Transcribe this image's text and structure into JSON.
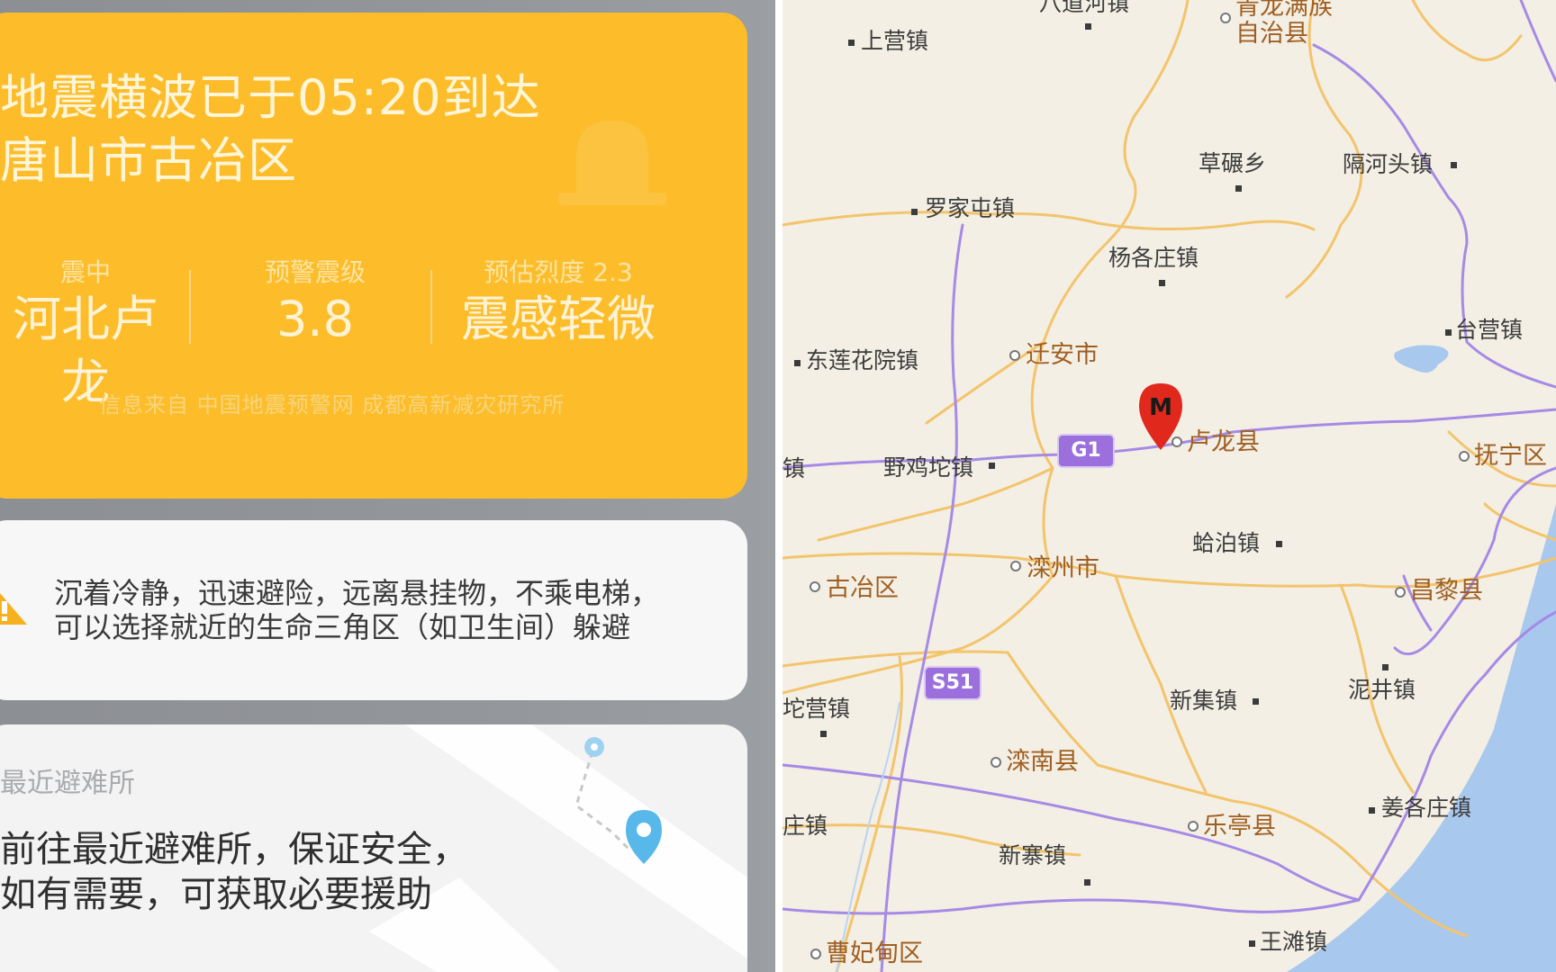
{
  "alert": {
    "title": "地震横波已于05:20到达\n唐山市古冶区",
    "epicenter_label": "震中",
    "epicenter_value": "河北卢龙",
    "magnitude_label": "预警震级",
    "magnitude_value": "3.8",
    "intensity_label": "预估烈度 2.3",
    "intensity_value": "震感轻微",
    "source": "信息来自 中国地震预警网 成都高新减灾研究所"
  },
  "advice": {
    "text": "沉着冷静，迅速避险，远离悬挂物，不乘电梯，\n可以选择就近的生命三角区（如卫生间）躲避"
  },
  "shelter": {
    "title": "最近避难所",
    "text": "前往最近避难所，保证安全，\n如有需要，可获取必要援助"
  },
  "map": {
    "places": [
      {
        "name": "八道河镇"
      },
      {
        "name": "青龙满族"
      },
      {
        "name": "自治县"
      },
      {
        "name": "上营镇"
      },
      {
        "name": "草碾乡"
      },
      {
        "name": "隔河头镇"
      },
      {
        "name": "罗家屯镇"
      },
      {
        "name": "杨各庄镇"
      },
      {
        "name": "台营镇"
      },
      {
        "name": "东莲花院镇"
      },
      {
        "name": "迁安市"
      },
      {
        "name": "卢龙县"
      },
      {
        "name": "抚宁区"
      },
      {
        "name": "野鸡坨镇"
      },
      {
        "name": "蛤泊镇"
      },
      {
        "name": "古冶区"
      },
      {
        "name": "滦州市"
      },
      {
        "name": "昌黎县"
      },
      {
        "name": "泥井镇"
      },
      {
        "name": "坨营镇"
      },
      {
        "name": "新集镇"
      },
      {
        "name": "滦南县"
      },
      {
        "name": "庄镇"
      },
      {
        "name": "姜各庄镇"
      },
      {
        "name": "乐亭县"
      },
      {
        "name": "新寨镇"
      },
      {
        "name": "王滩镇"
      },
      {
        "name": "曹妃甸区"
      },
      {
        "name": "镇"
      }
    ],
    "highways": {
      "g1": "G1",
      "s51": "S51"
    },
    "marker_label": "M"
  },
  "colors": {
    "alert_bg": "#fdbd2b",
    "road_orange": "#f3c46c",
    "road_purple": "#a58ae6",
    "water": "#a9c8ee"
  }
}
